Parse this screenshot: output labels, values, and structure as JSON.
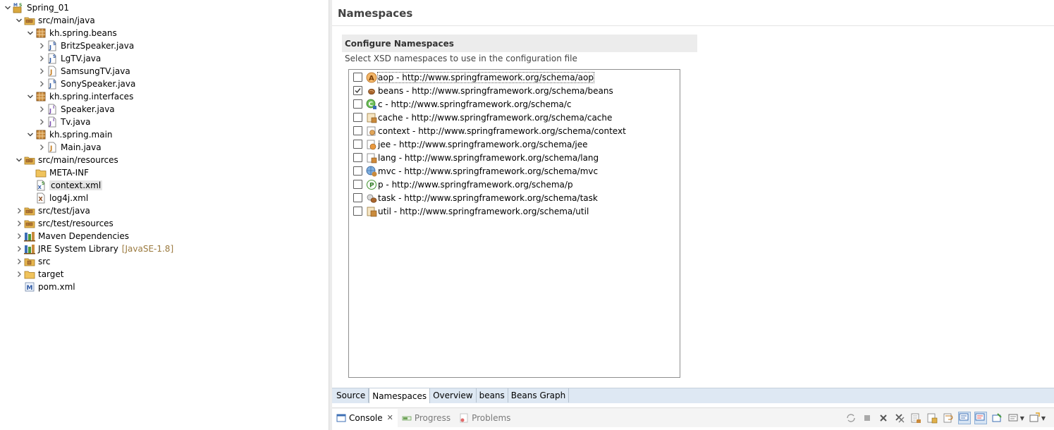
{
  "tree": {
    "items": [
      {
        "label": "Spring_01",
        "decoration": "",
        "indent": 0,
        "chevron": "expanded",
        "icon": "maven-spring-project-icon"
      },
      {
        "label": "src/main/java",
        "decoration": "",
        "indent": 1,
        "chevron": "expanded",
        "icon": "source-folder-icon"
      },
      {
        "label": "kh.spring.beans",
        "decoration": "",
        "indent": 2,
        "chevron": "expanded",
        "icon": "package-icon"
      },
      {
        "label": "BritzSpeaker.java",
        "decoration": "",
        "indent": 3,
        "chevron": "collapsed",
        "icon": "java-spring-bean-icon"
      },
      {
        "label": "LgTV.java",
        "decoration": "",
        "indent": 3,
        "chevron": "collapsed",
        "icon": "java-spring-bean-icon"
      },
      {
        "label": "SamsungTV.java",
        "decoration": "",
        "indent": 3,
        "chevron": "collapsed",
        "icon": "java-file-icon"
      },
      {
        "label": "SonySpeaker.java",
        "decoration": "",
        "indent": 3,
        "chevron": "collapsed",
        "icon": "java-spring-bean-icon"
      },
      {
        "label": "kh.spring.interfaces",
        "decoration": "",
        "indent": 2,
        "chevron": "expanded",
        "icon": "package-icon"
      },
      {
        "label": "Speaker.java",
        "decoration": "",
        "indent": 3,
        "chevron": "collapsed",
        "icon": "java-interface-icon"
      },
      {
        "label": "Tv.java",
        "decoration": "",
        "indent": 3,
        "chevron": "collapsed",
        "icon": "java-interface-icon"
      },
      {
        "label": "kh.spring.main",
        "decoration": "",
        "indent": 2,
        "chevron": "expanded",
        "icon": "package-icon"
      },
      {
        "label": "Main.java",
        "decoration": "",
        "indent": 3,
        "chevron": "collapsed",
        "icon": "java-file-icon"
      },
      {
        "label": "src/main/resources",
        "decoration": "",
        "indent": 1,
        "chevron": "expanded",
        "icon": "source-folder-icon"
      },
      {
        "label": "META-INF",
        "decoration": "",
        "indent": 2,
        "chevron": "none",
        "icon": "folder-icon"
      },
      {
        "label": "context.xml",
        "decoration": "",
        "indent": 2,
        "chevron": "none",
        "icon": "spring-xml-icon",
        "selected": true
      },
      {
        "label": "log4j.xml",
        "decoration": "",
        "indent": 2,
        "chevron": "none",
        "icon": "xml-file-icon"
      },
      {
        "label": "src/test/java",
        "decoration": "",
        "indent": 1,
        "chevron": "collapsed",
        "icon": "source-folder-icon"
      },
      {
        "label": "src/test/resources",
        "decoration": "",
        "indent": 1,
        "chevron": "collapsed",
        "icon": "source-folder-icon"
      },
      {
        "label": "Maven Dependencies",
        "decoration": "",
        "indent": 1,
        "chevron": "collapsed",
        "icon": "library-icon"
      },
      {
        "label": "JRE System Library",
        "decoration": "[JavaSE-1.8]",
        "indent": 1,
        "chevron": "collapsed",
        "icon": "library-icon"
      },
      {
        "label": "src",
        "decoration": "",
        "indent": 1,
        "chevron": "collapsed",
        "icon": "src-folder-icon"
      },
      {
        "label": "target",
        "decoration": "",
        "indent": 1,
        "chevron": "collapsed",
        "icon": "folder-icon"
      },
      {
        "label": "pom.xml",
        "decoration": "",
        "indent": 1,
        "chevron": "none",
        "icon": "maven-pom-icon"
      }
    ]
  },
  "editor": {
    "title": "Namespaces",
    "section_title": "Configure Namespaces",
    "section_description": "Select XSD namespaces to use in the configuration file",
    "namespaces": [
      {
        "label": "aop - http://www.springframework.org/schema/aop",
        "checked": false,
        "icon": "aop-icon",
        "focused": true
      },
      {
        "label": "beans - http://www.springframework.org/schema/beans",
        "checked": true,
        "icon": "bean-icon"
      },
      {
        "label": "c - http://www.springframework.org/schema/c",
        "checked": false,
        "icon": "c-namespace-icon"
      },
      {
        "label": "cache - http://www.springframework.org/schema/cache",
        "checked": false,
        "icon": "cache-icon"
      },
      {
        "label": "context - http://www.springframework.org/schema/context",
        "checked": false,
        "icon": "context-icon"
      },
      {
        "label": "jee - http://www.springframework.org/schema/jee",
        "checked": false,
        "icon": "jee-icon"
      },
      {
        "label": "lang - http://www.springframework.org/schema/lang",
        "checked": false,
        "icon": "lang-icon"
      },
      {
        "label": "mvc - http://www.springframework.org/schema/mvc",
        "checked": false,
        "icon": "mvc-icon"
      },
      {
        "label": "p - http://www.springframework.org/schema/p",
        "checked": false,
        "icon": "p-namespace-icon"
      },
      {
        "label": "task - http://www.springframework.org/schema/task",
        "checked": false,
        "icon": "task-icon"
      },
      {
        "label": "util - http://www.springframework.org/schema/util",
        "checked": false,
        "icon": "util-icon"
      }
    ],
    "tabs": [
      {
        "label": "Source",
        "active": false
      },
      {
        "label": "Namespaces",
        "active": true
      },
      {
        "label": "Overview",
        "active": false
      },
      {
        "label": "beans",
        "active": false
      },
      {
        "label": "Beans Graph",
        "active": false
      }
    ]
  },
  "bottom_panel": {
    "views": [
      {
        "label": "Console",
        "active": true,
        "icon": "console-icon",
        "closable": true
      },
      {
        "label": "Progress",
        "active": false,
        "icon": "progress-icon"
      },
      {
        "label": "Problems",
        "active": false,
        "icon": "problems-icon"
      }
    ],
    "close_glyph": "✕",
    "toolbar": [
      "sync-icon",
      "terminate-icon",
      "remove-launch-icon",
      "remove-all-terminated-icon",
      "clear-console-icon",
      "scroll-lock-icon",
      "word-wrap-icon",
      "show-on-stdout-icon",
      "show-on-stderr-icon",
      "pin-console-icon",
      "display-console-icon",
      "open-console-icon"
    ]
  }
}
